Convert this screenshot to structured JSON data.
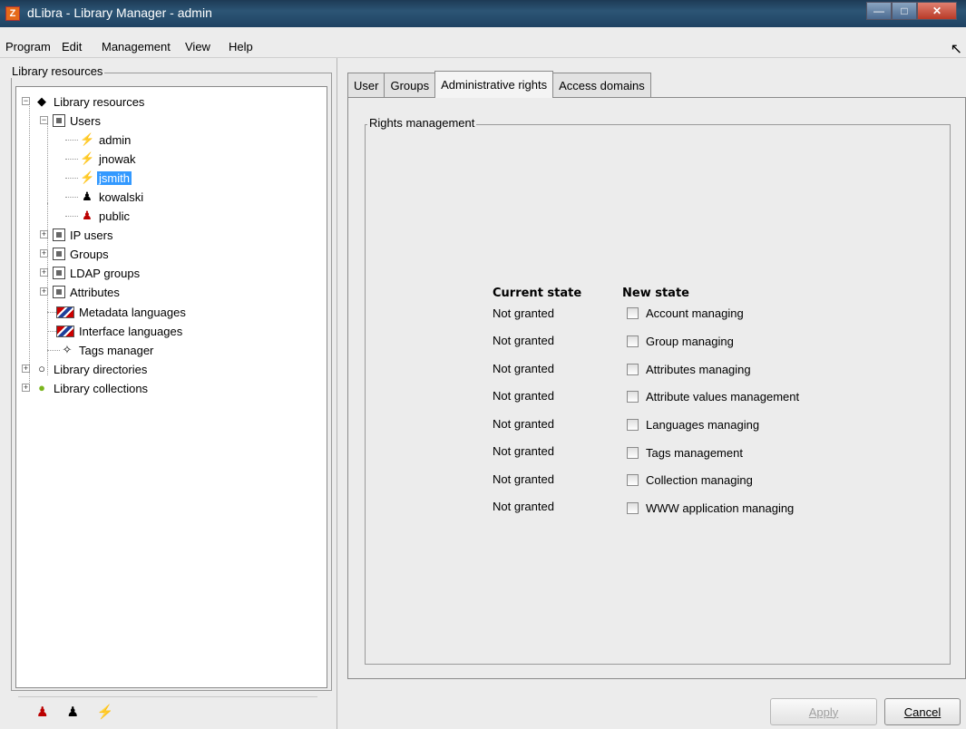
{
  "window": {
    "title": "dLibra - Library Manager - admin",
    "app_icon_text": "Z"
  },
  "menu": [
    "Program",
    "Edit",
    "Management",
    "View",
    "Help"
  ],
  "left": {
    "group_title": "Library resources",
    "tree": {
      "root": "Library resources",
      "users_label": "Users",
      "users": [
        "admin",
        "jnowak",
        "jsmith",
        "kowalski",
        "public"
      ],
      "selected_user": "jsmith",
      "other_nodes": [
        "IP users",
        "Groups",
        "LDAP groups",
        "Attributes",
        "Metadata languages",
        "Interface languages",
        "Tags manager"
      ],
      "top_nodes": [
        "Library directories",
        "Library collections"
      ]
    }
  },
  "tabs": [
    "User",
    "Groups",
    "Administrative rights",
    "Access domains"
  ],
  "active_tab": "Administrative rights",
  "rights": {
    "group_title": "Rights management",
    "current_state_header": "Current state",
    "new_state_header": "New state",
    "rows": [
      {
        "current": "Not granted",
        "label": "Account managing",
        "checked": false
      },
      {
        "current": "Not granted",
        "label": "Group managing",
        "checked": false
      },
      {
        "current": "Not granted",
        "label": "Attributes managing",
        "checked": false
      },
      {
        "current": "Not granted",
        "label": "Attribute values management",
        "checked": false
      },
      {
        "current": "Not granted",
        "label": "Languages managing",
        "checked": false
      },
      {
        "current": "Not granted",
        "label": "Tags management",
        "checked": false
      },
      {
        "current": "Not granted",
        "label": "Collection managing",
        "checked": false
      },
      {
        "current": "Not granted",
        "label": "WWW application managing",
        "checked": false
      }
    ]
  },
  "buttons": {
    "apply_label": "Apply",
    "apply_enabled": false,
    "cancel_label": "Cancel"
  }
}
